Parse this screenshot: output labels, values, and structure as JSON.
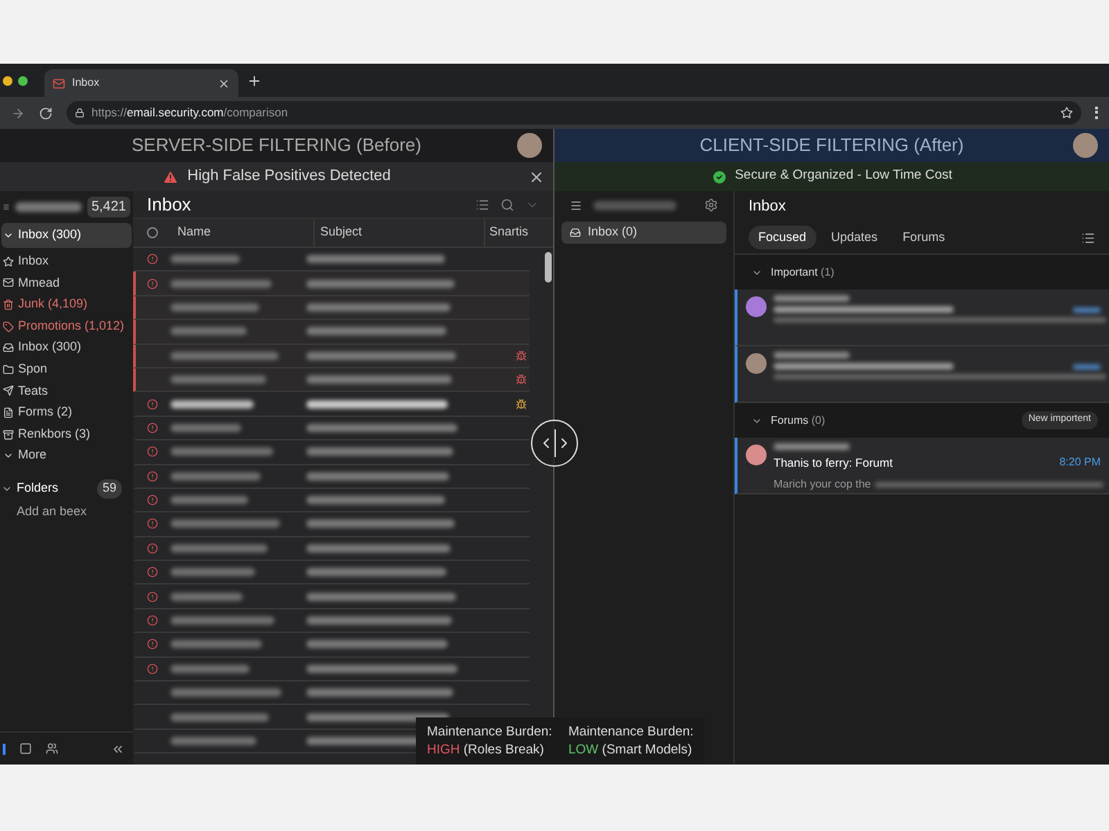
{
  "browser": {
    "tab_title": "Inbox",
    "url_prefix": "https://",
    "url_host": "email.security.com",
    "url_path": "/comparison"
  },
  "before": {
    "title": "SERVER-SIDE FILTERING (Before)",
    "banner": "High False Positives Detected",
    "count": "5,421",
    "sidebar": [
      {
        "label": "Inbox (300)",
        "selected": true,
        "warning": false
      },
      {
        "label": "Inbox",
        "selected": false,
        "warning": false
      },
      {
        "label": "Mmead",
        "selected": false,
        "warning": false
      },
      {
        "label": "Junk (4,109)",
        "selected": false,
        "warning": true
      },
      {
        "label": "Promotions (1,012)",
        "selected": false,
        "warning": true
      },
      {
        "label": "Inbox (300)",
        "selected": false,
        "warning": false
      },
      {
        "label": "Spon",
        "selected": false,
        "warning": false
      },
      {
        "label": "Teats",
        "selected": false,
        "warning": false
      },
      {
        "label": "Forms (2)",
        "selected": false,
        "warning": false
      },
      {
        "label": "Renkbors (3)",
        "selected": false,
        "warning": false
      },
      {
        "label": "More",
        "selected": false,
        "warning": false
      }
    ],
    "folders": {
      "label": "Folders",
      "count": "59",
      "add": "Add an beex"
    },
    "list_title": "Inbox",
    "select_all": {
      "checked": false
    },
    "columns": [
      "Name",
      "Subject",
      "Snartis"
    ],
    "rows": [
      {
        "alert": true,
        "flagged": false,
        "unread": false
      },
      {
        "alert": true,
        "flagged": true,
        "unread": false
      },
      {
        "alert": false,
        "flagged": true,
        "unread": false
      },
      {
        "alert": false,
        "flagged": true,
        "unread": false
      },
      {
        "alert": false,
        "flagged": true,
        "unread": false,
        "bug": {
          "color": "#d0545a"
        }
      },
      {
        "alert": false,
        "flagged": true,
        "unread": false,
        "bug": {
          "color": "#d0545a"
        }
      },
      {
        "alert": true,
        "flagged": false,
        "unread": true,
        "bug": {
          "color": "#d6a23a"
        }
      },
      {
        "alert": true,
        "flagged": false,
        "unread": false
      },
      {
        "alert": true,
        "flagged": false,
        "unread": false
      },
      {
        "alert": true,
        "flagged": false,
        "unread": false
      },
      {
        "alert": true,
        "flagged": false,
        "unread": false
      },
      {
        "alert": true,
        "flagged": false,
        "unread": false
      },
      {
        "alert": true,
        "flagged": false,
        "unread": false
      },
      {
        "alert": true,
        "flagged": false,
        "unread": false
      },
      {
        "alert": true,
        "flagged": false,
        "unread": false
      },
      {
        "alert": true,
        "flagged": false,
        "unread": false
      },
      {
        "alert": true,
        "flagged": false,
        "unread": false
      },
      {
        "alert": true,
        "flagged": false,
        "unread": false
      },
      {
        "alert": false,
        "flagged": false,
        "unread": false
      },
      {
        "alert": false,
        "flagged": false,
        "unread": false
      },
      {
        "alert": false,
        "flagged": false,
        "unread": false
      }
    ],
    "burden": {
      "label": "Maintenance Burden:",
      "level": "HIGH",
      "note": "(Roles Break)"
    }
  },
  "after": {
    "title": "CLIENT-SIDE FILTERING (After)",
    "banner": "Secure & Organized - Low Time Cost",
    "sidebar": [
      {
        "label": "Inbox (0)",
        "selected": true
      }
    ],
    "list_title": "Inbox",
    "tabs": [
      {
        "label": "Focused",
        "selected": true
      },
      {
        "label": "Updates",
        "selected": false
      },
      {
        "label": "Forums",
        "selected": false
      }
    ],
    "sections": [
      {
        "title": "Important",
        "count": "(1)",
        "emails": [
          {
            "avatar": {
              "kind": "letters",
              "color": "#a678d8"
            }
          },
          {
            "avatar": {
              "kind": "photo"
            }
          }
        ]
      },
      {
        "title": "Forums",
        "count": "(0)",
        "action": "New importent",
        "emails": [
          {
            "avatar": {
              "kind": "letters",
              "color": "#d98c8c"
            },
            "subject": "Thanis to ferry: Forumt",
            "time": "8:20 PM",
            "preview": "Marich your cop the"
          }
        ]
      }
    ],
    "burden": {
      "label": "Maintenance Burden:",
      "level": "LOW",
      "note": "(Smart Models)"
    }
  }
}
